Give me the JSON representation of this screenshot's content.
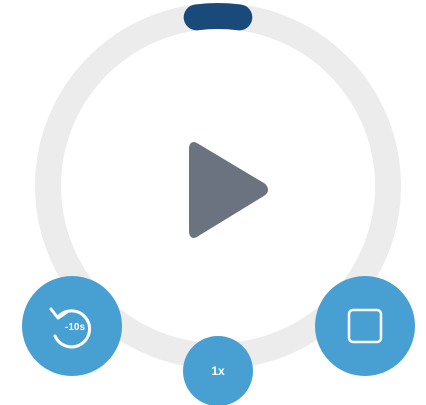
{
  "colors": {
    "ring_track": "#ececec",
    "progress": "#1a4a7a",
    "play_icon": "#6b7380",
    "button_bg": "#47a0d1",
    "button_icon": "#ffffff"
  },
  "progress": {
    "fraction": 0.04
  },
  "controls": {
    "play": {
      "icon": "play-icon"
    },
    "rewind": {
      "icon": "rewind-icon",
      "label": "-10s"
    },
    "stop": {
      "icon": "stop-icon"
    },
    "speed": {
      "label": "1x"
    }
  }
}
